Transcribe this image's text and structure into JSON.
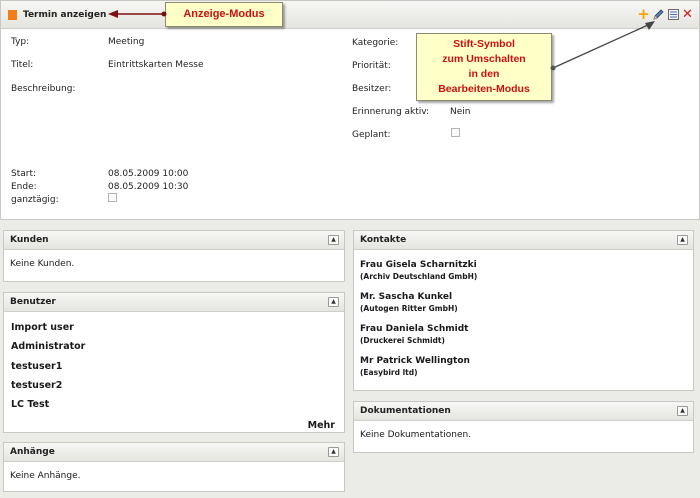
{
  "appointment": {
    "title": "Termin anzeigen",
    "fields_left": [
      {
        "label": "Typ:",
        "value": "Meeting"
      },
      {
        "label": "Titel:",
        "value": "Eintrittskarten Messe"
      },
      {
        "label": "Beschreibung:",
        "value": ""
      }
    ],
    "fields_right": [
      {
        "label": "Kategorie:",
        "value": ""
      },
      {
        "label": "Priorität:",
        "value": ""
      },
      {
        "label": "Besitzer:",
        "value": ""
      },
      {
        "label": "Erinnerung aktiv:",
        "value": "Nein"
      },
      {
        "label": "Geplant:",
        "value": ""
      }
    ],
    "start_label": "Start:",
    "start_value": "08.05.2009 10:00",
    "end_label": "Ende:",
    "end_value": "08.05.2009 10:30",
    "allday_label": "ganztägig:"
  },
  "callouts": {
    "mode": "Anzeige-Modus",
    "pen": [
      "Stift-Symbol",
      "zum Umschalten",
      "in den",
      "Bearbeiten-Modus"
    ]
  },
  "kunden": {
    "title": "Kunden",
    "empty": "Keine Kunden."
  },
  "benutzer": {
    "title": "Benutzer",
    "items": [
      "Import user",
      "Administrator",
      "testuser1",
      "testuser2",
      "LC Test"
    ],
    "more": "Mehr"
  },
  "anhaenge": {
    "title": "Anhänge",
    "empty": "Keine Anhänge."
  },
  "kontakte": {
    "title": "Kontakte",
    "items": [
      {
        "name": "Frau Gisela Scharnitzki",
        "org": "(Archiv Deutschland GmbH)"
      },
      {
        "name": "Mr. Sascha Kunkel",
        "org": "(Autogen Ritter GmbH)"
      },
      {
        "name": "Frau Daniela Schmidt",
        "org": "(Druckerei Schmidt)"
      },
      {
        "name": "Mr Patrick Wellington",
        "org": "(Easybird ltd)"
      }
    ]
  },
  "dokumentationen": {
    "title": "Dokumentationen",
    "empty": "Keine Dokumentationen."
  },
  "colors": {
    "accent_orange": "#f07c1a",
    "callout_text": "#cc1010",
    "callout_bg": "#ffffc8"
  },
  "icons": [
    "add-icon",
    "pencil-icon",
    "list-icon",
    "delete-icon",
    "collapse-icon"
  ]
}
